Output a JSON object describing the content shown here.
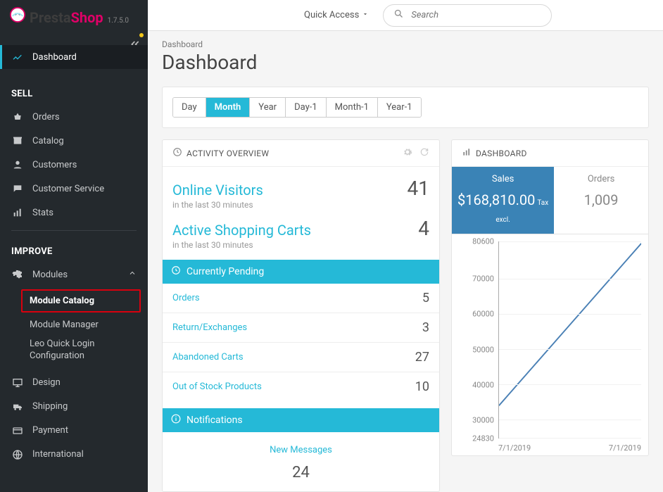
{
  "brand": {
    "name_a": "Presta",
    "name_b": "Shop",
    "version": "1.7.5.0"
  },
  "topbar": {
    "quick_access": "Quick Access",
    "search_placeholder": "Search"
  },
  "header": {
    "breadcrumb": "Dashboard",
    "title": "Dashboard"
  },
  "sidebar": {
    "dashboard": "Dashboard",
    "section_sell": "SELL",
    "orders": "Orders",
    "catalog": "Catalog",
    "customers": "Customers",
    "customer_service": "Customer Service",
    "stats": "Stats",
    "section_improve": "IMPROVE",
    "modules": "Modules",
    "module_catalog": "Module Catalog",
    "module_manager": "Module Manager",
    "leo_quick_login": "Leo Quick Login Configuration",
    "design": "Design",
    "shipping": "Shipping",
    "payment": "Payment",
    "international": "International"
  },
  "period": {
    "day": "Day",
    "month": "Month",
    "year": "Year",
    "day1": "Day-1",
    "month1": "Month-1",
    "year1": "Year-1"
  },
  "activity": {
    "title": "ACTIVITY OVERVIEW",
    "online_visitors": "Online Visitors",
    "online_sub": "in the last 30 minutes",
    "online_val": "41",
    "carts": "Active Shopping Carts",
    "carts_sub": "in the last 30 minutes",
    "carts_val": "4",
    "pending_title": "Currently Pending",
    "pending": [
      {
        "label": "Orders",
        "val": "5"
      },
      {
        "label": "Return/Exchanges",
        "val": "3"
      },
      {
        "label": "Abandoned Carts",
        "val": "27"
      },
      {
        "label": "Out of Stock Products",
        "val": "10"
      }
    ],
    "notif_title": "Notifications",
    "notif_label": "New Messages",
    "notif_val": "24"
  },
  "dashboard_card": {
    "title": "DASHBOARD",
    "tabs": {
      "sales_label": "Sales",
      "sales_value": "$168,810.00",
      "tax_note": "Tax excl.",
      "orders_label": "Orders",
      "orders_value": "1,009"
    }
  },
  "chart_data": {
    "type": "line",
    "xlabel": "",
    "ylabel": "",
    "ylim": [
      24830,
      80600
    ],
    "y_ticks": [
      "80600",
      "70000",
      "60000",
      "50000",
      "40000",
      "30000",
      "24830"
    ],
    "x_ticks": [
      "7/1/2019",
      "7/1/2019"
    ],
    "series": [
      {
        "name": "Sales",
        "x": [
          0,
          1
        ],
        "values": [
          34000,
          80000
        ]
      }
    ]
  }
}
